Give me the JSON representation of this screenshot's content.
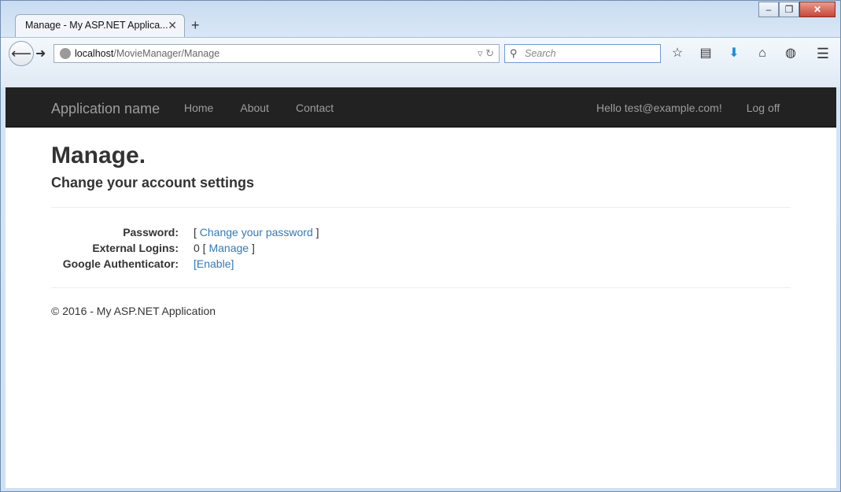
{
  "browser": {
    "tab_title": "Manage - My ASP.NET Applica...",
    "url_host": "localhost",
    "url_path": "/MovieManager/Manage",
    "search_placeholder": "Search",
    "window_buttons": {
      "minimize": "‒",
      "restore": "❐",
      "close": "✕"
    }
  },
  "site": {
    "brand": "Application name",
    "nav": [
      "Home",
      "About",
      "Contact"
    ],
    "greeting": "Hello test@example.com!",
    "logoff": "Log off"
  },
  "page": {
    "title": "Manage.",
    "subtitle": "Change your account settings",
    "settings": [
      {
        "label": "Password:",
        "prefix": "[ ",
        "link": "Change your password",
        "suffix": " ]"
      },
      {
        "label": "External Logins:",
        "prefix": "0 [ ",
        "link": "Manage",
        "suffix": " ]"
      },
      {
        "label": "Google Authenticator:",
        "prefix": "",
        "link": "[Enable]",
        "suffix": ""
      }
    ],
    "footer": "© 2016 - My ASP.NET Application"
  },
  "colors": {
    "navbar_bg": "#222222",
    "nav_text": "#9d9d9d",
    "link": "#337ab7",
    "downloads_icon": "#1c8ed8"
  },
  "icons": [
    "back-arrow-icon",
    "forward-arrow-icon",
    "globe-icon",
    "reload-icon",
    "search-icon",
    "bookmark-star-icon",
    "reading-list-icon",
    "download-arrow-icon",
    "home-icon",
    "globe-addon-icon",
    "hamburger-menu-icon"
  ]
}
